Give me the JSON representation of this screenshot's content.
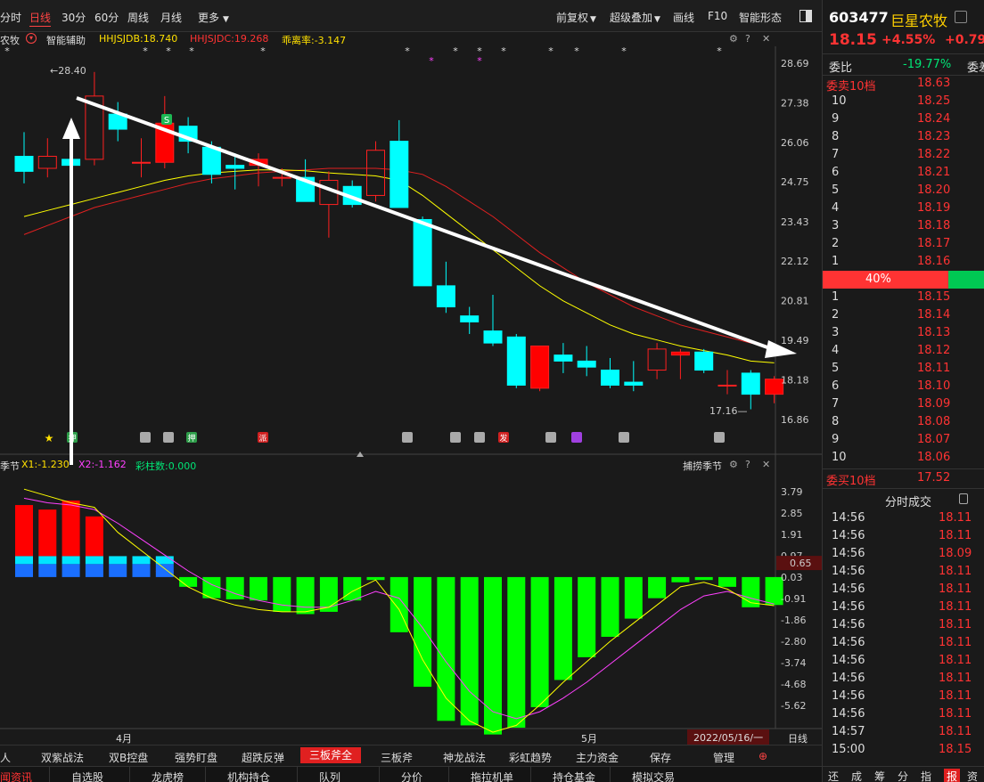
{
  "toolbar": {
    "periods": [
      "分时",
      "日线",
      "30分",
      "60分",
      "周线",
      "月线"
    ],
    "active_period": "日线",
    "more": "更多",
    "right": [
      "前复权",
      "超级叠加",
      "画线",
      "F10",
      "智能形态"
    ]
  },
  "indicator": {
    "prefix": "农牧",
    "assist": "智能辅助",
    "hhjsjdb": "HHJSJDB:18.740",
    "hhjsjdc": "HHJSJDC:19.268",
    "deviation": "乖离率:-3.147"
  },
  "sub_indicator": {
    "prefix": "季节",
    "x1": "X1:-1.230",
    "x2": "X2:-1.162",
    "bars": "彩柱数:0.000",
    "name": "捕捞季节"
  },
  "colors": {
    "up": "#ff0000",
    "down": "#00ffff",
    "ma_yellow": "#ffff00",
    "ma_red": "#e02020",
    "macd_pos": "#ff0000",
    "macd_neg": "#00ff00"
  },
  "chart_data": {
    "type": "candlestick",
    "main_yticks": [
      "28.69",
      "27.38",
      "26.06",
      "24.75",
      "23.43",
      "22.12",
      "20.81",
      "19.49",
      "18.18",
      "16.86"
    ],
    "sub_yticks": [
      "3.79",
      "2.85",
      "1.91",
      "0.97",
      "0.03",
      "-0.91",
      "-1.86",
      "-2.80",
      "-3.74",
      "-4.68",
      "-5.62"
    ],
    "sub_current": "0.65",
    "high_label": "28.40",
    "low_label": "17.16",
    "x_labels": [
      "4月",
      "5月"
    ],
    "date": "2022/05/16/一",
    "period_label": "日线",
    "candles": [
      {
        "o": 25.6,
        "c": 25.1,
        "h": 26.4,
        "l": 24.7
      },
      {
        "o": 25.2,
        "c": 25.6,
        "h": 26.2,
        "l": 24.9
      },
      {
        "o": 25.5,
        "c": 25.3,
        "h": 25.8,
        "l": 24.9
      },
      {
        "o": 25.5,
        "c": 27.6,
        "h": 28.4,
        "l": 25.3
      },
      {
        "o": 27.0,
        "c": 26.5,
        "h": 27.4,
        "l": 26.1
      },
      {
        "o": 25.4,
        "c": 25.4,
        "h": 26.2,
        "l": 24.9
      },
      {
        "o": 25.4,
        "c": 26.7,
        "h": 27.6,
        "l": 25.2
      },
      {
        "o": 26.6,
        "c": 26.1,
        "h": 26.9,
        "l": 25.7
      },
      {
        "o": 25.9,
        "c": 25.0,
        "h": 26.1,
        "l": 24.7
      },
      {
        "o": 25.3,
        "c": 25.2,
        "h": 25.7,
        "l": 24.5
      },
      {
        "o": 25.3,
        "c": 25.5,
        "h": 25.7,
        "l": 24.6
      },
      {
        "o": 24.9,
        "c": 24.9,
        "h": 25.2,
        "l": 24.6
      },
      {
        "o": 24.9,
        "c": 24.1,
        "h": 25.5,
        "l": 24.1
      },
      {
        "o": 24.0,
        "c": 24.8,
        "h": 25.1,
        "l": 22.9
      },
      {
        "o": 24.6,
        "c": 24.0,
        "h": 24.8,
        "l": 23.9
      },
      {
        "o": 24.3,
        "c": 25.8,
        "h": 26.1,
        "l": 24.1
      },
      {
        "o": 26.1,
        "c": 23.9,
        "h": 26.8,
        "l": 23.9
      },
      {
        "o": 23.5,
        "c": 21.3,
        "h": 23.6,
        "l": 21.3
      },
      {
        "o": 21.3,
        "c": 20.6,
        "h": 22.1,
        "l": 20.4
      },
      {
        "o": 20.3,
        "c": 20.1,
        "h": 20.6,
        "l": 19.7
      },
      {
        "o": 19.8,
        "c": 19.4,
        "h": 21.0,
        "l": 19.3
      },
      {
        "o": 19.6,
        "c": 18.0,
        "h": 19.7,
        "l": 17.9
      },
      {
        "o": 17.9,
        "c": 19.3,
        "h": 19.3,
        "l": 17.8
      },
      {
        "o": 19.0,
        "c": 18.8,
        "h": 19.4,
        "l": 18.4
      },
      {
        "o": 18.8,
        "c": 18.6,
        "h": 19.3,
        "l": 18.3
      },
      {
        "o": 18.5,
        "c": 18.0,
        "h": 18.9,
        "l": 17.9
      },
      {
        "o": 18.1,
        "c": 18.0,
        "h": 18.8,
        "l": 17.8
      },
      {
        "o": 18.5,
        "c": 19.2,
        "h": 19.4,
        "l": 18.2
      },
      {
        "o": 19.0,
        "c": 19.1,
        "h": 19.2,
        "l": 18.2
      },
      {
        "o": 19.1,
        "c": 18.5,
        "h": 19.2,
        "l": 18.4
      },
      {
        "o": 18.0,
        "c": 18.0,
        "h": 18.5,
        "l": 17.7
      },
      {
        "o": 18.4,
        "c": 17.7,
        "h": 18.5,
        "l": 17.2
      },
      {
        "o": 17.7,
        "c": 18.2,
        "h": 18.3,
        "l": 17.4
      }
    ],
    "ma_yellow": [
      23.6,
      23.8,
      24.0,
      24.2,
      24.4,
      24.6,
      24.8,
      24.95,
      25.05,
      25.1,
      25.15,
      25.15,
      25.12,
      25.05,
      25.0,
      24.95,
      24.8,
      24.3,
      23.7,
      23.1,
      22.5,
      21.9,
      21.3,
      20.8,
      20.4,
      20.0,
      19.7,
      19.5,
      19.3,
      19.15,
      19.0,
      18.8,
      18.74
    ],
    "ma_red": [
      23.0,
      23.3,
      23.6,
      23.9,
      24.1,
      24.3,
      24.5,
      24.7,
      24.85,
      24.95,
      25.05,
      25.1,
      25.15,
      25.2,
      25.2,
      25.2,
      25.15,
      25.0,
      24.6,
      24.1,
      23.6,
      23.0,
      22.4,
      21.9,
      21.4,
      21.0,
      20.6,
      20.3,
      20.0,
      19.8,
      19.6,
      19.4,
      19.27
    ],
    "macd": [
      3.2,
      3.0,
      3.4,
      2.7,
      0.95,
      0.85,
      0.3,
      -0.4,
      -0.9,
      -0.95,
      -1.0,
      -1.5,
      -1.6,
      -1.5,
      -1.0,
      -0.1,
      -2.4,
      -4.8,
      -6.3,
      -6.5,
      -6.9,
      -6.6,
      -5.7,
      -4.5,
      -3.5,
      -2.6,
      -1.8,
      -0.9,
      -0.2,
      -0.1,
      -0.4,
      -1.3,
      -1.2
    ],
    "macd_base": [
      0.95,
      0.95,
      0.95,
      0.95,
      0.95,
      0.65,
      0.3,
      0,
      0,
      0,
      0,
      0,
      0,
      0,
      0,
      0,
      0,
      0,
      0,
      0,
      0,
      0,
      0,
      0,
      0,
      0,
      0,
      0,
      0,
      0,
      0,
      0,
      0
    ],
    "x1": [
      3.9,
      3.6,
      3.3,
      3.1,
      2.0,
      1.2,
      0.4,
      -0.4,
      -0.9,
      -1.2,
      -1.4,
      -1.5,
      -1.5,
      -1.3,
      -0.6,
      -0.1,
      -1.4,
      -3.6,
      -5.3,
      -6.3,
      -6.8,
      -6.5,
      -5.6,
      -4.6,
      -3.7,
      -2.8,
      -2.0,
      -1.2,
      -0.4,
      -0.2,
      -0.5,
      -1.1,
      -1.23
    ],
    "x2": [
      3.5,
      3.3,
      3.2,
      3.0,
      2.4,
      1.7,
      1.0,
      0.3,
      -0.3,
      -0.7,
      -1.0,
      -1.2,
      -1.3,
      -1.3,
      -1.0,
      -0.6,
      -0.9,
      -2.2,
      -3.7,
      -5.0,
      -5.9,
      -6.2,
      -5.9,
      -5.3,
      -4.6,
      -3.8,
      -3.0,
      -2.2,
      -1.4,
      -0.8,
      -0.6,
      -0.9,
      -1.16
    ]
  },
  "markers": {
    "stars_top": [
      "*",
      "*",
      "*",
      "*",
      "*",
      "*",
      "*",
      "*",
      "*",
      "*",
      "*",
      "*",
      "*"
    ],
    "stars_magenta": [
      "*",
      "*"
    ],
    "s_badge": "S",
    "event_icons": [
      "押",
      "押",
      "派",
      "发"
    ]
  },
  "right_panel": {
    "code": "603477",
    "name": "巨星农牧",
    "price": "18.15",
    "change_pct": "+4.55%",
    "change": "+0.79",
    "weibi_label": "委比",
    "weibi_value": "-19.77%",
    "weicha_label": "委差",
    "sell_header": "委卖10档",
    "sell_header_price": "18.63",
    "sell_levels": [
      {
        "lvl": "10",
        "price": "18.25"
      },
      {
        "lvl": "9",
        "price": "18.24"
      },
      {
        "lvl": "8",
        "price": "18.23"
      },
      {
        "lvl": "7",
        "price": "18.22"
      },
      {
        "lvl": "6",
        "price": "18.21"
      },
      {
        "lvl": "5",
        "price": "18.20"
      },
      {
        "lvl": "4",
        "price": "18.19"
      },
      {
        "lvl": "3",
        "price": "18.18"
      },
      {
        "lvl": "2",
        "price": "18.17"
      },
      {
        "lvl": "1",
        "price": "18.16"
      }
    ],
    "ratio_label": "40%",
    "buy_levels": [
      {
        "lvl": "1",
        "price": "18.15"
      },
      {
        "lvl": "2",
        "price": "18.14"
      },
      {
        "lvl": "3",
        "price": "18.13"
      },
      {
        "lvl": "4",
        "price": "18.12"
      },
      {
        "lvl": "5",
        "price": "18.11"
      },
      {
        "lvl": "6",
        "price": "18.10"
      },
      {
        "lvl": "7",
        "price": "18.09"
      },
      {
        "lvl": "8",
        "price": "18.08"
      },
      {
        "lvl": "9",
        "price": "18.07"
      },
      {
        "lvl": "10",
        "price": "18.06"
      }
    ],
    "buy_header": "委买10档",
    "buy_header_price": "17.52",
    "ticks_title": "分时成交",
    "ticks": [
      {
        "t": "14:56",
        "p": "18.11"
      },
      {
        "t": "14:56",
        "p": "18.11"
      },
      {
        "t": "14:56",
        "p": "18.09"
      },
      {
        "t": "14:56",
        "p": "18.11"
      },
      {
        "t": "14:56",
        "p": "18.11"
      },
      {
        "t": "14:56",
        "p": "18.11"
      },
      {
        "t": "14:56",
        "p": "18.11"
      },
      {
        "t": "14:56",
        "p": "18.11"
      },
      {
        "t": "14:56",
        "p": "18.11"
      },
      {
        "t": "14:56",
        "p": "18.11"
      },
      {
        "t": "14:56",
        "p": "18.11"
      },
      {
        "t": "14:56",
        "p": "18.11"
      },
      {
        "t": "14:57",
        "p": "18.11"
      },
      {
        "t": "15:00",
        "p": "18.15"
      }
    ],
    "bottom_tabs": [
      "还",
      "成",
      "筹",
      "分",
      "指",
      "报",
      "资"
    ],
    "active_bottom_tab": "报"
  },
  "bottom_tabs": [
    "人",
    "双紫战法",
    "双B控盘",
    "强势盯盘",
    "超跌反弹",
    "三板斧全",
    "三板斧",
    "神龙战法",
    "彩虹趋势",
    "主力资金",
    "保存",
    "管理"
  ],
  "active_bottom_tab": "三板斧全",
  "bottom_nav": [
    "闻资讯",
    "自选股",
    "龙虎榜",
    "机构持仓",
    "队列",
    "分价",
    "拖拉机单",
    "持仓基金",
    "模拟交易"
  ]
}
